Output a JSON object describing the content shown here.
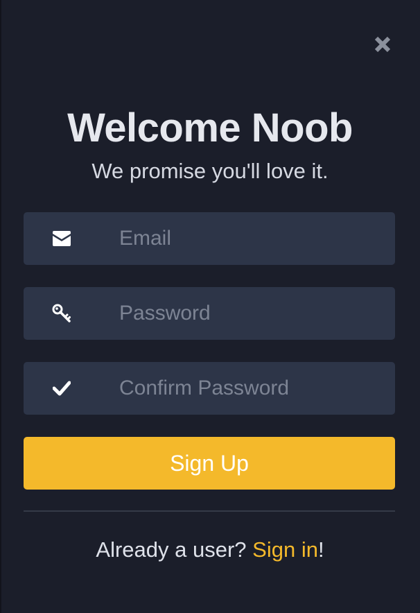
{
  "modal": {
    "title": "Welcome Noob",
    "subtitle": "We promise you'll love it."
  },
  "form": {
    "email": {
      "placeholder": "Email",
      "value": "",
      "icon": "envelope-icon"
    },
    "password": {
      "placeholder": "Password",
      "value": "",
      "icon": "key-icon"
    },
    "confirm_password": {
      "placeholder": "Confirm Password",
      "value": "",
      "icon": "check-icon"
    },
    "submit_label": "Sign Up"
  },
  "footer": {
    "prompt": "Already a user? ",
    "link_label": "Sign in",
    "suffix": "!"
  },
  "colors": {
    "background": "#1b1e2a",
    "field_background": "#2d3548",
    "accent": "#f4b92b",
    "text": "#e6e8ee",
    "placeholder": "#7d8494"
  }
}
